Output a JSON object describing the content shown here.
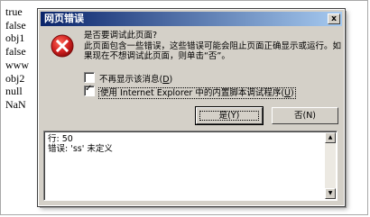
{
  "page": {
    "lines": [
      "true",
      "false",
      "obj1",
      "false",
      "www",
      "obj2",
      "null",
      "NaN"
    ]
  },
  "dialog": {
    "title": "网页错误",
    "close_glyph": "x",
    "message": [
      "是否要调试此页面?",
      "此页面包含一些错误，这些错误可能会阻止页面正确显示或运行。如",
      "果现在不想调试此页面，则单击“否”。"
    ],
    "checkbox_dont_show": {
      "label": "不再显示该消息(",
      "hotkey": "D",
      "suffix": ")",
      "checked": false
    },
    "checkbox_use_debugger": {
      "label": "使用 Internet Explorer 中的内置脚本调试程序(",
      "hotkey": "U",
      "suffix": ")",
      "checked": true,
      "mark": "✓"
    },
    "yes_button": "是(Y)",
    "no_button": "否(N)",
    "details": [
      "行: 50",
      "错误: 'ss' 未定义"
    ],
    "scroll_up_glyph": "▲",
    "scroll_down_glyph": "▼"
  },
  "colors": {
    "title_bar_start": "#0a246a",
    "title_bar_end": "#a6caf0",
    "dialog_face": "#d4d0c8",
    "error_icon": "#d02020"
  },
  "icons": {
    "error": "error-circle-x-icon"
  }
}
